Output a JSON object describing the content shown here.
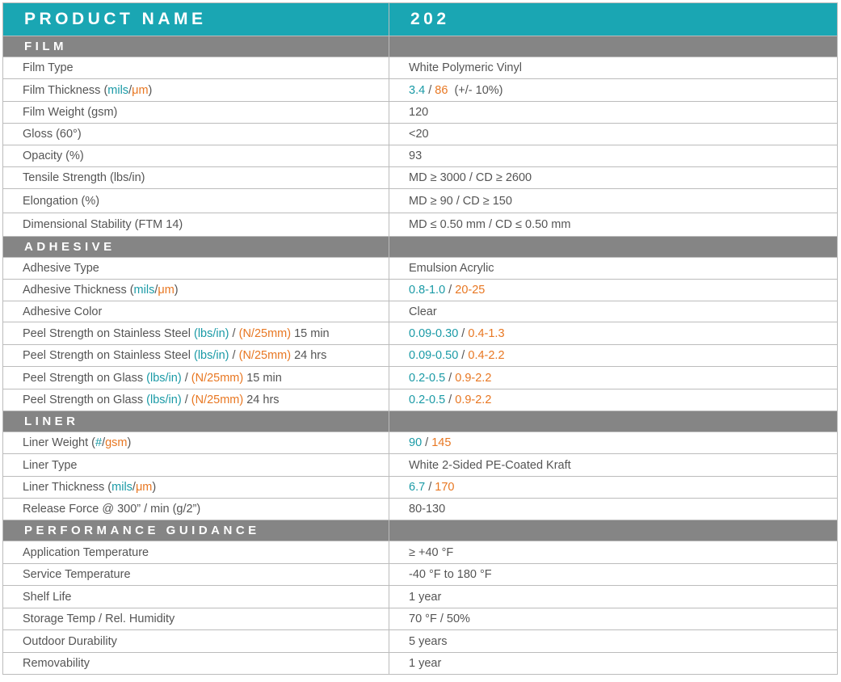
{
  "header": {
    "label": "PRODUCT NAME",
    "value": "202"
  },
  "sections": [
    {
      "title": "FILM",
      "rows": [
        {
          "name": [
            [
              "Film Type",
              "p"
            ]
          ],
          "value": [
            [
              "White Polymeric Vinyl",
              "p"
            ]
          ]
        },
        {
          "name": [
            [
              "Film Thickness (",
              "p"
            ],
            [
              "mils",
              "t"
            ],
            [
              "/",
              "p"
            ],
            [
              "μm",
              "o"
            ],
            [
              ")",
              "p"
            ]
          ],
          "value": [
            [
              "3.4",
              "t"
            ],
            [
              " / ",
              "p"
            ],
            [
              "86",
              "o"
            ],
            [
              "  (+/- 10%)",
              "p"
            ]
          ]
        },
        {
          "name": [
            [
              "Film Weight (gsm)",
              "p"
            ]
          ],
          "value": [
            [
              "120",
              "p"
            ]
          ]
        },
        {
          "name": [
            [
              "Gloss (60°)",
              "p"
            ]
          ],
          "value": [
            [
              "<20",
              "p"
            ]
          ]
        },
        {
          "name": [
            [
              "Opacity (%)",
              "p"
            ]
          ],
          "value": [
            [
              "93",
              "p"
            ]
          ]
        },
        {
          "name": [
            [
              "Tensile Strength (lbs/in)",
              "p"
            ]
          ],
          "value": [
            [
              "MD ≥ 3000 / CD ≥ 2600",
              "p"
            ]
          ]
        },
        {
          "name": [
            [
              "Elongation (%)",
              "p"
            ]
          ],
          "value": [
            [
              "MD ≥ 90 / CD ≥ 150",
              "p"
            ]
          ]
        },
        {
          "name": [
            [
              "Dimensional Stability (FTM 14)",
              "p"
            ]
          ],
          "value": [
            [
              "MD ≤ 0.50 mm / CD ≤ 0.50 mm",
              "p"
            ]
          ]
        }
      ]
    },
    {
      "title": "ADHESIVE",
      "rows": [
        {
          "name": [
            [
              "Adhesive Type",
              "p"
            ]
          ],
          "value": [
            [
              "Emulsion Acrylic",
              "p"
            ]
          ]
        },
        {
          "name": [
            [
              "Adhesive Thickness (",
              "p"
            ],
            [
              "mils",
              "t"
            ],
            [
              "/",
              "p"
            ],
            [
              "μm",
              "o"
            ],
            [
              ")",
              "p"
            ]
          ],
          "value": [
            [
              "0.8-1.0",
              "t"
            ],
            [
              " / ",
              "p"
            ],
            [
              "20-25",
              "o"
            ]
          ]
        },
        {
          "name": [
            [
              "Adhesive Color",
              "p"
            ]
          ],
          "value": [
            [
              "Clear",
              "p"
            ]
          ]
        },
        {
          "name": [
            [
              "Peel Strength on Stainless Steel ",
              "p"
            ],
            [
              "(lbs/in)",
              "t"
            ],
            [
              " / ",
              "p"
            ],
            [
              "(N/25mm)",
              "o"
            ],
            [
              " 15 min",
              "p"
            ]
          ],
          "value": [
            [
              "0.09-0.30",
              "t"
            ],
            [
              " / ",
              "p"
            ],
            [
              "0.4-1.3",
              "o"
            ]
          ]
        },
        {
          "name": [
            [
              "Peel Strength on Stainless Steel ",
              "p"
            ],
            [
              "(lbs/in)",
              "t"
            ],
            [
              " / ",
              "p"
            ],
            [
              "(N/25mm)",
              "o"
            ],
            [
              " 24 hrs",
              "p"
            ]
          ],
          "value": [
            [
              "0.09-0.50",
              "t"
            ],
            [
              " / ",
              "p"
            ],
            [
              "0.4-2.2",
              "o"
            ]
          ]
        },
        {
          "name": [
            [
              "Peel Strength on Glass ",
              "p"
            ],
            [
              "(lbs/in)",
              "t"
            ],
            [
              " / ",
              "p"
            ],
            [
              "(N/25mm)",
              "o"
            ],
            [
              " 15 min",
              "p"
            ]
          ],
          "value": [
            [
              "0.2-0.5",
              "t"
            ],
            [
              " / ",
              "p"
            ],
            [
              "0.9-2.2",
              "o"
            ]
          ]
        },
        {
          "name": [
            [
              "Peel Strength on Glass ",
              "p"
            ],
            [
              "(lbs/in)",
              "t"
            ],
            [
              " / ",
              "p"
            ],
            [
              "(N/25mm)",
              "o"
            ],
            [
              " 24 hrs",
              "p"
            ]
          ],
          "value": [
            [
              "0.2-0.5",
              "t"
            ],
            [
              " / ",
              "p"
            ],
            [
              "0.9-2.2",
              "o"
            ]
          ]
        }
      ]
    },
    {
      "title": "LINER",
      "rows": [
        {
          "name": [
            [
              "Liner Weight (",
              "p"
            ],
            [
              "#",
              "t"
            ],
            [
              "/",
              "p"
            ],
            [
              "gsm",
              "o"
            ],
            [
              ")",
              "p"
            ]
          ],
          "value": [
            [
              "90",
              "t"
            ],
            [
              " / ",
              "p"
            ],
            [
              "145",
              "o"
            ]
          ]
        },
        {
          "name": [
            [
              "Liner Type",
              "p"
            ]
          ],
          "value": [
            [
              "White 2-Sided PE-Coated Kraft",
              "p"
            ]
          ]
        },
        {
          "name": [
            [
              "Liner Thickness (",
              "p"
            ],
            [
              "mils",
              "t"
            ],
            [
              "/",
              "p"
            ],
            [
              "μm",
              "o"
            ],
            [
              ")",
              "p"
            ]
          ],
          "value": [
            [
              "6.7",
              "t"
            ],
            [
              " / ",
              "p"
            ],
            [
              "170",
              "o"
            ]
          ]
        },
        {
          "name": [
            [
              "Release Force @ 300” / min (g/2”)",
              "p"
            ]
          ],
          "value": [
            [
              "80-130",
              "p"
            ]
          ]
        }
      ]
    },
    {
      "title": "PERFORMANCE GUIDANCE",
      "rows": [
        {
          "name": [
            [
              "Application Temperature",
              "p"
            ]
          ],
          "value": [
            [
              "≥ +40 °F",
              "p"
            ]
          ]
        },
        {
          "name": [
            [
              "Service Temperature",
              "p"
            ]
          ],
          "value": [
            [
              "-40 °F to 180 °F",
              "p"
            ]
          ]
        },
        {
          "name": [
            [
              "Shelf Life",
              "p"
            ]
          ],
          "value": [
            [
              "1 year",
              "p"
            ]
          ]
        },
        {
          "name": [
            [
              "Storage Temp / Rel. Humidity",
              "p"
            ]
          ],
          "value": [
            [
              "70 °F / 50%",
              "p"
            ]
          ]
        },
        {
          "name": [
            [
              "Outdoor Durability",
              "p"
            ]
          ],
          "value": [
            [
              "5 years",
              "p"
            ]
          ]
        },
        {
          "name": [
            [
              "Removability",
              "p"
            ]
          ],
          "value": [
            [
              "1 year",
              "p"
            ]
          ]
        }
      ]
    }
  ],
  "colors": {
    "header_teal": "#1aa6b3",
    "section_gray": "#858585",
    "imperial_teal": "#1a9aa6",
    "metric_orange": "#e87722",
    "text_gray": "#555555"
  }
}
